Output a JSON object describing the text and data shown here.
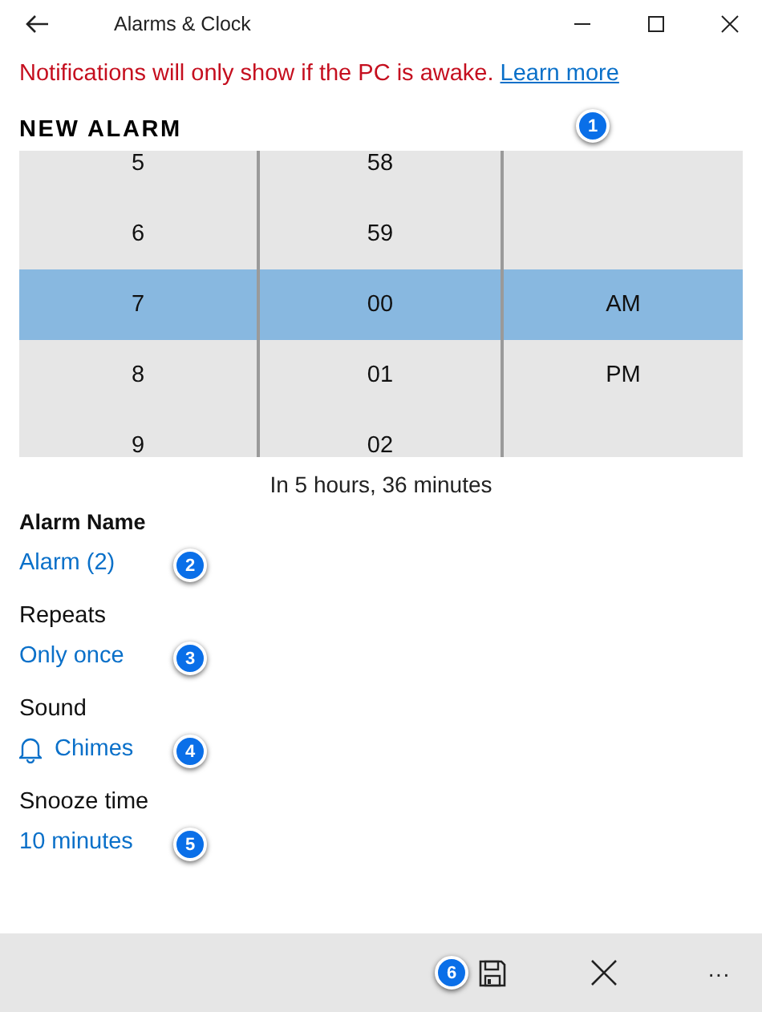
{
  "window": {
    "title": "Alarms & Clock"
  },
  "notice": {
    "text": "Notifications will only show if the PC is awake.",
    "link": "Learn more"
  },
  "heading": {
    "text": "NEW ALARM",
    "marker": "1"
  },
  "picker": {
    "columns": [
      {
        "items": [
          {
            "text": "5",
            "selected": false
          },
          {
            "text": "6",
            "selected": false
          },
          {
            "text": "7",
            "selected": true
          },
          {
            "text": "8",
            "selected": false
          },
          {
            "text": "9",
            "selected": false
          }
        ]
      },
      {
        "items": [
          {
            "text": "58",
            "selected": false
          },
          {
            "text": "59",
            "selected": false
          },
          {
            "text": "00",
            "selected": true
          },
          {
            "text": "01",
            "selected": false
          },
          {
            "text": "02",
            "selected": false
          }
        ]
      },
      {
        "items": [
          {
            "text": "AM",
            "selected": true
          },
          {
            "text": "PM",
            "selected": false
          }
        ]
      }
    ]
  },
  "countdown": "In 5 hours, 36 minutes",
  "fields": [
    {
      "label": "Alarm Name",
      "value": "Alarm (2)",
      "marker": "2"
    },
    {
      "label": "Repeats",
      "value": "Only once",
      "marker": "3"
    },
    {
      "label": "Sound",
      "value": "Chimes",
      "kind": "sound",
      "marker": "4"
    },
    {
      "label": "Snooze time",
      "value": "10 minutes",
      "marker": "5"
    }
  ],
  "command_bar": {
    "marker": "6",
    "more": "···"
  }
}
